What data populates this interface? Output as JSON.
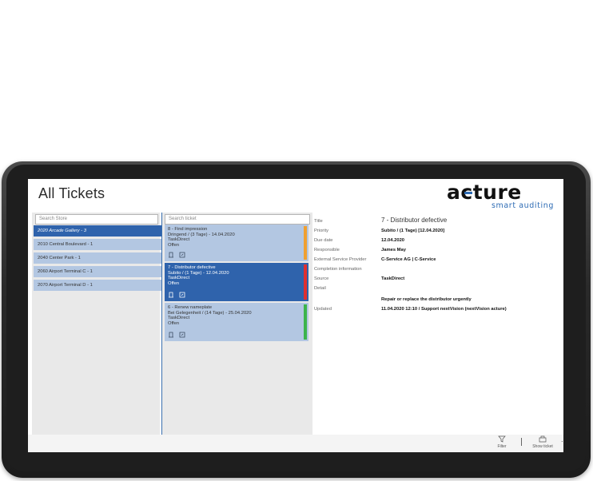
{
  "app": {
    "title": "All Tickets"
  },
  "logo": {
    "word": "acture",
    "tagline": "smart auditing",
    "accent_color": "#2d6bb4"
  },
  "stores": {
    "search_placeholder": "Search Store",
    "items": [
      {
        "label": "2020 Arcade Gallery - 3",
        "selected": true
      },
      {
        "label": "2010 Central Boulevard - 1",
        "selected": false
      },
      {
        "label": "2040 Center Park - 1",
        "selected": false
      },
      {
        "label": "2060 Airport Terminal C - 1",
        "selected": false
      },
      {
        "label": "2070 Airport Terminal D - 1",
        "selected": false
      }
    ]
  },
  "tickets": {
    "search_placeholder": "Search ticket",
    "items": [
      {
        "title": "8 - Find impression",
        "priority": "Dringend / (3 Tage) - 14.04.2020",
        "source": "TaskDirect",
        "status": "Offen",
        "stripe_color": "#f0a030",
        "selected": false
      },
      {
        "title": "7 - Distributor defective",
        "priority": "Subito / (1 Tage) - 12.04.2020",
        "source": "TaskDirect",
        "status": "Offen",
        "stripe_color": "#e03030",
        "selected": true
      },
      {
        "title": "6 - Renew nameplate",
        "priority": "Bei Gelegenheit / (14 Tage) - 25.04.2020",
        "source": "TaskDirect",
        "status": "Offen",
        "stripe_color": "#3cb44b",
        "selected": false
      }
    ]
  },
  "detail": {
    "title_label": "Title",
    "title_value": "7 - Distributor defective",
    "priority_label": "Priority",
    "priority_value": "Subito / (1 Tage) [12.04.2020]",
    "due_label": "Due date",
    "due_value": "12.04.2020",
    "responsible_label": "Responsible",
    "responsible_value": "James May",
    "esp_label": "External Service Provider",
    "esp_value": "C-Service AG | C-Service",
    "completion_label": "Completion information",
    "source_label": "Source",
    "source_value": "TaskDirect",
    "detail_label": "Detail",
    "detail_value": "Repair or replace the distributor urgently",
    "updated_label": "Updated",
    "updated_value": "11.04.2020 12:10 / Support nextVision (nextVision acture)"
  },
  "appbar": {
    "filter_label": "Filter",
    "show_ticket_label": "Show ticket",
    "more_label": "..."
  }
}
